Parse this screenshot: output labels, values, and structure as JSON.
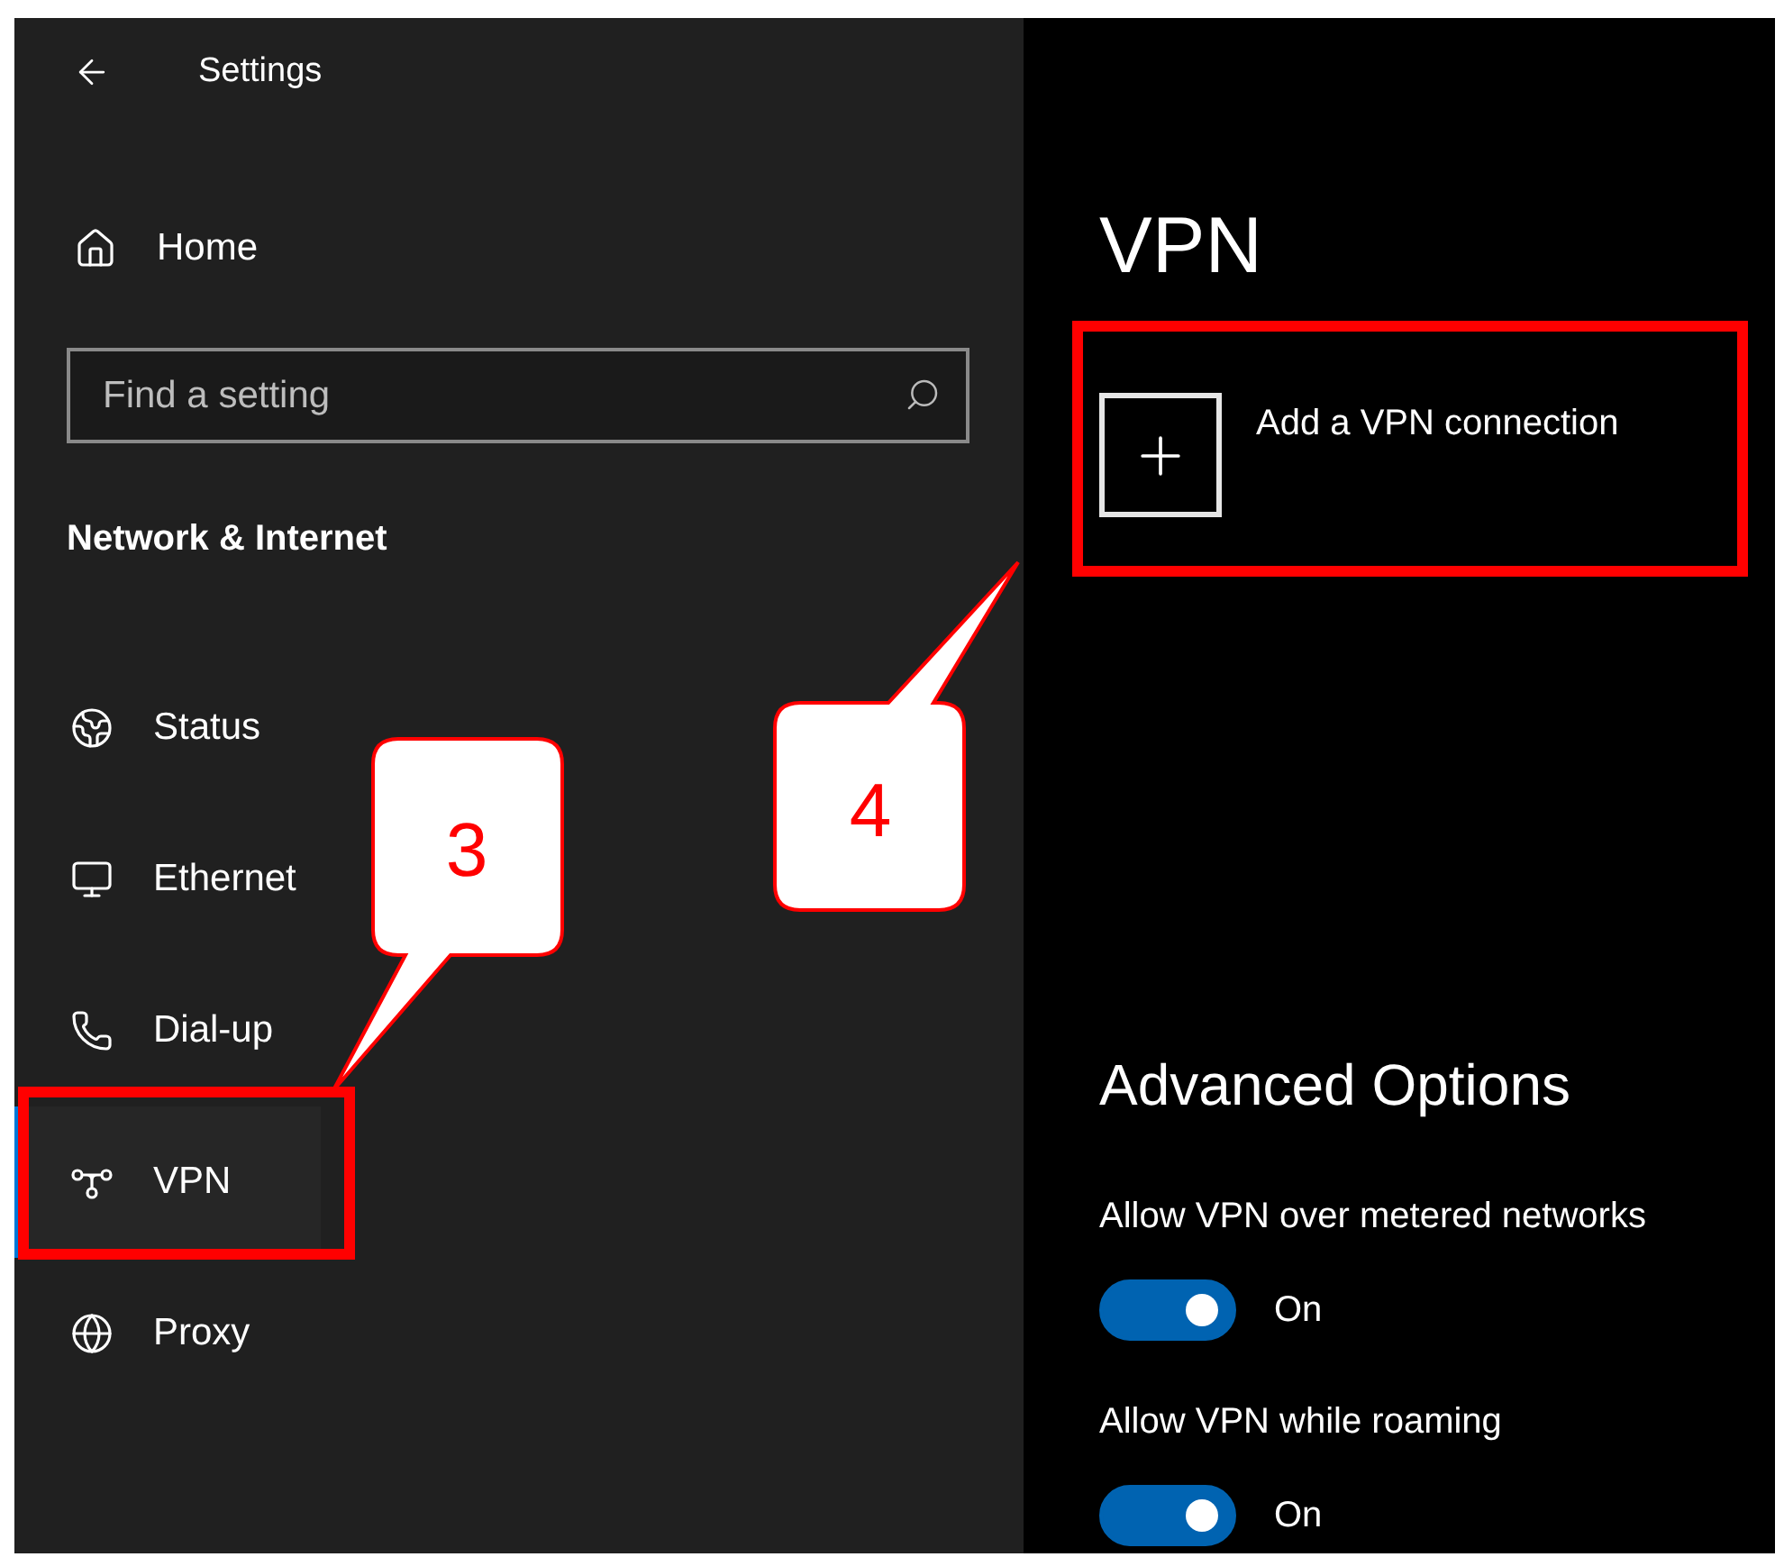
{
  "window": {
    "title": "Settings"
  },
  "sidebar": {
    "home": "Home",
    "search": {
      "placeholder": "Find a setting"
    },
    "section": "Network & Internet",
    "items": [
      {
        "label": "Status",
        "selected": false,
        "highlighted": false
      },
      {
        "label": "Ethernet",
        "selected": false,
        "highlighted": false
      },
      {
        "label": "Dial-up",
        "selected": false,
        "highlighted": false
      },
      {
        "label": "VPN",
        "selected": true,
        "highlighted": true
      },
      {
        "label": "Proxy",
        "selected": false,
        "highlighted": false
      }
    ]
  },
  "page": {
    "title": "VPN",
    "add_connection": {
      "label": "Add a VPN connection",
      "highlighted": true
    },
    "advanced": {
      "title": "Advanced Options",
      "options": [
        {
          "label": "Allow VPN over metered networks",
          "on": true,
          "state_label": "On"
        },
        {
          "label": "Allow VPN while roaming",
          "on": true,
          "state_label": "On"
        }
      ]
    }
  },
  "callouts": [
    {
      "number": "3"
    },
    {
      "number": "4"
    }
  ]
}
